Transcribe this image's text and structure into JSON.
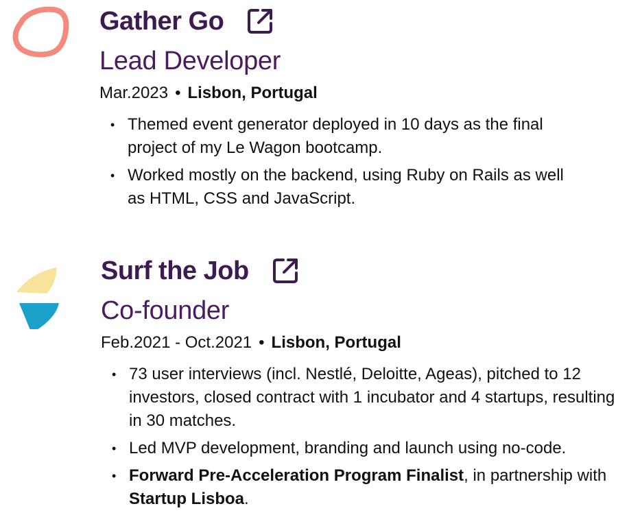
{
  "experience": [
    {
      "company": "Gather Go",
      "logo": "gather-go-logo",
      "link_icon": "external-link-icon",
      "role": "Lead Developer",
      "date": "Mar.2023",
      "separator": "•",
      "location": "Lisbon, Portugal",
      "bullets": [
        {
          "parts": [
            {
              "text": "Themed event generator deployed in 10 days as the final project of my Le Wagon bootcamp.",
              "bold": false
            }
          ]
        },
        {
          "parts": [
            {
              "text": "Worked mostly on the backend, using Ruby on Rails as well as HTML, CSS and JavaScript.",
              "bold": false
            }
          ]
        }
      ]
    },
    {
      "company": "Surf the Job",
      "logo": "surf-the-job-logo",
      "link_icon": "external-link-icon",
      "role": "Co-founder",
      "date": "Feb.2021 - Oct.2021",
      "separator": "•",
      "location": "Lisbon, Portugal",
      "bullets": [
        {
          "parts": [
            {
              "text": "73 user interviews (incl. Nestlé, Deloitte, Ageas), pitched to 12 investors, closed contract with 1 incubator and 4 startups, resulting in 30 matches.",
              "bold": false
            }
          ]
        },
        {
          "parts": [
            {
              "text": "Led MVP development, branding and launch using no-code.",
              "bold": false
            }
          ]
        },
        {
          "parts": [
            {
              "text": "Forward Pre-Acceleration Program Finalist",
              "bold": true
            },
            {
              "text": ", in partnership with ",
              "bold": false
            },
            {
              "text": "Startup Lisboa",
              "bold": true
            },
            {
              "text": ".",
              "bold": false
            }
          ]
        }
      ]
    }
  ],
  "colors": {
    "heading": "#3d1a4f",
    "role": "#4a1b5e",
    "gather_logo": "#f28b7d",
    "surf_yellow": "#f7e49a",
    "surf_blue": "#1aa0c9"
  }
}
